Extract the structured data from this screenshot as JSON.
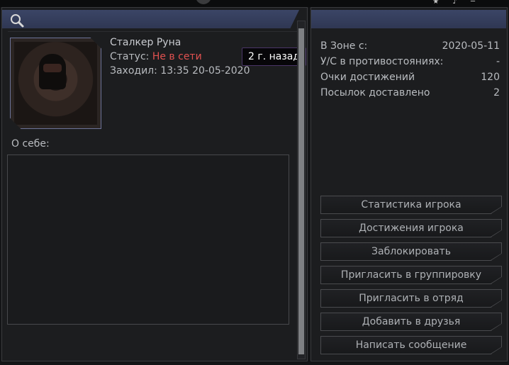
{
  "profile": {
    "name": "Сталкер Руна",
    "status_label": "Статус:",
    "status_value": "Не в сети",
    "last_seen_label": "Заходил:",
    "last_seen_value": "13:35 20-05-2020",
    "tooltip": "2 г. назад",
    "about_label": "О себе:"
  },
  "stats": [
    {
      "label": "В Зоне с:",
      "value": "2020-05-11"
    },
    {
      "label": "У/С в противостояниях:",
      "value": "-"
    },
    {
      "label": "Очки достижений",
      "value": "120"
    },
    {
      "label": "Посылок доставлено",
      "value": "2"
    }
  ],
  "actions": [
    {
      "label": "Статистика игрока"
    },
    {
      "label": "Достижения игрока"
    },
    {
      "label": "Заблокировать"
    },
    {
      "label": "Пригласить в группировку"
    },
    {
      "label": "Пригласить в отряд"
    },
    {
      "label": "Добавить в друзья"
    },
    {
      "label": "Написать сообщение"
    }
  ],
  "colors": {
    "header": "#36405f",
    "status_offline": "#e05150",
    "panel_bg": "#1c1d1f",
    "tooltip_border": "#4a3567"
  },
  "icons": {
    "search": "search-icon"
  }
}
